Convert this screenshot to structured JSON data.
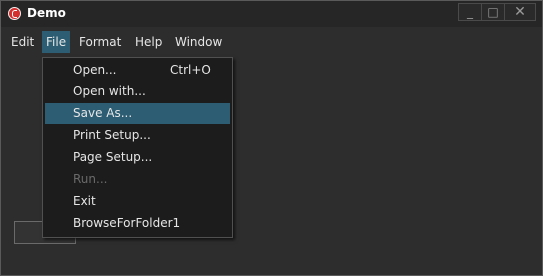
{
  "window": {
    "title": "Demo",
    "controls": {
      "minimize": "_",
      "maximize": "□",
      "close": "✕"
    },
    "app_icon": "app-logo-icon"
  },
  "menubar": {
    "items": [
      {
        "label": "Edit"
      },
      {
        "label": "File",
        "active": true
      },
      {
        "label": "Format"
      },
      {
        "label": "Help"
      },
      {
        "label": "Window"
      }
    ]
  },
  "file_menu": {
    "items": [
      {
        "label": "Open...",
        "shortcut": "Ctrl+O"
      },
      {
        "label": "Open with..."
      },
      {
        "label": "Save As...",
        "selected": true
      },
      {
        "label": "Print Setup..."
      },
      {
        "label": "Page Setup..."
      },
      {
        "label": "Run...",
        "disabled": true
      },
      {
        "label": "Exit"
      },
      {
        "label": "BrowseForFolder1"
      }
    ]
  },
  "colors": {
    "background": "#2d2d2d",
    "highlight": "#2c5d73",
    "menu_background": "#1c1c1c",
    "close_icon": "#d32f2f"
  }
}
